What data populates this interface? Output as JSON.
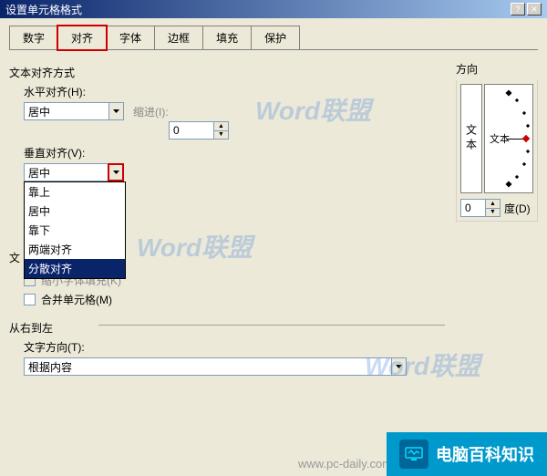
{
  "window": {
    "title": "设置单元格格式"
  },
  "tabs": [
    "数字",
    "对齐",
    "字体",
    "边框",
    "填充",
    "保护"
  ],
  "textAlign": {
    "title": "文本对齐方式",
    "horizLabel": "水平对齐(H):",
    "horizValue": "居中",
    "indentLabel": "缩进(I):",
    "indentValue": "0",
    "vertLabel": "垂直对齐(V):",
    "vertValue": "居中",
    "vertOptions": [
      "靠上",
      "居中",
      "靠下",
      "两端对齐",
      "分散对齐"
    ]
  },
  "textControl": {
    "title": "文",
    "shrinkLabel": "缩小字体填充(K)",
    "mergeLabel": "合并单元格(M)"
  },
  "rtl": {
    "title": "从右到左",
    "dirLabel": "文字方向(T):",
    "dirValue": "根据内容"
  },
  "orientation": {
    "title": "方向",
    "verticalText": "文本",
    "dialText": "文本",
    "degreeValue": "0",
    "degreeLabel": "度(D)"
  },
  "watermark": "Word联盟",
  "footer": {
    "brand": "电脑百科知识",
    "url": "www.pc-daily.com"
  }
}
